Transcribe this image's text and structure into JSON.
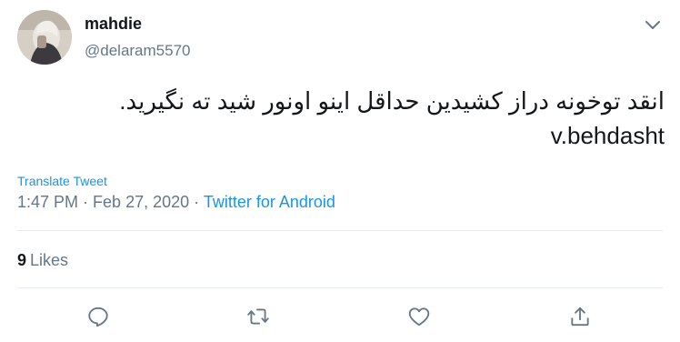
{
  "author": {
    "name": "mahdie",
    "handle": "@delaram5570"
  },
  "tweet": {
    "line1": "انقد توخونه دراز کشیدین حداقل اینو اونور شید ته نگیرید.",
    "line2": "v.behdasht"
  },
  "translate_label": "Translate Tweet",
  "meta": {
    "time": "1:47 PM",
    "separator1": " · ",
    "date": "Feb 27, 2020",
    "separator2": " · ",
    "source": "Twitter for Android"
  },
  "stats": {
    "likes_count": "9",
    "likes_label": "Likes"
  },
  "icons": {
    "more": "chevron-down-icon",
    "reply": "reply-icon",
    "retweet": "retweet-icon",
    "like": "heart-icon",
    "share": "share-icon"
  },
  "colors": {
    "link": "#1b95e0",
    "secondary": "#657786",
    "primary": "#14171a",
    "icon": "#657786",
    "divider": "#e6ecf0"
  }
}
